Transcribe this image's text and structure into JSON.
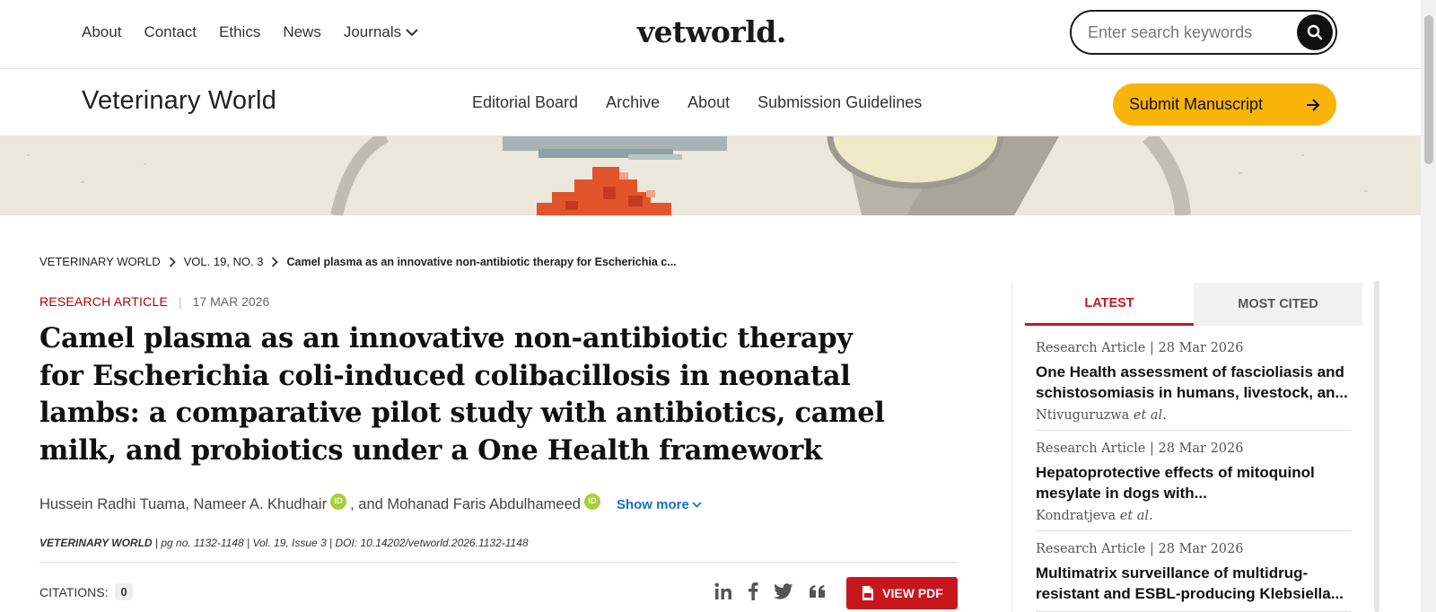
{
  "topnav": {
    "items": [
      "About",
      "Contact",
      "Ethics",
      "News"
    ],
    "journals_label": "Journals"
  },
  "site_logo": "vetworld.",
  "search": {
    "placeholder": "Enter search keywords"
  },
  "journal": {
    "title": "Veterinary World",
    "nav": [
      "Editorial Board",
      "Archive",
      "About",
      "Submission Guidelines"
    ],
    "submit_label": "Submit Manuscript"
  },
  "breadcrumb": {
    "items": [
      "VETERINARY WORLD",
      "VOL. 19, NO. 3"
    ],
    "current": "Camel plasma as an innovative non-antibiotic therapy for Escherichia c..."
  },
  "article": {
    "type": "RESEARCH ARTICLE",
    "date": "17 MAR 2026",
    "title": "Camel plasma as an innovative non-antibiotic therapy for Escherichia coli-induced colibacillosis in neonatal lambs: a comparative pilot study with antibiotics, camel milk, and probiotics under a One Health framework",
    "authors": {
      "a1": "Hussein Radhi Tuama, Nameer A. Khudhair",
      "a2": ", and Mohanad Faris Abdulhameed",
      "orcid_label": "iD",
      "show_more": "Show more"
    },
    "citation": {
      "journal": "VETERINARY WORLD",
      "rest": " | pg no. 1132-1148 | Vol. 19, Issue 3 | DOI: 10.14202/vetworld.2026.1132-1148"
    },
    "citations_label": "CITATIONS:",
    "citations_count": "0",
    "view_pdf": "VIEW PDF"
  },
  "sidebar": {
    "tabs": [
      "LATEST",
      "MOST CITED"
    ],
    "items": [
      {
        "meta": "Research Article | 28 Mar 2026",
        "title": "One Health assessment of fascioliasis and schistosomiasis in humans, livestock, an...",
        "author": "Ntivuguruzwa",
        "etal": "et al."
      },
      {
        "meta": "Research Article | 28 Mar 2026",
        "title": "Hepatoprotective effects of mitoquinol mesylate in dogs with...",
        "author": "Kondratjeva",
        "etal": "et al."
      },
      {
        "meta": "Research Article | 28 Mar 2026",
        "title": "Multimatrix surveillance of multidrug-resistant and ESBL-producing Klebsiella...",
        "author": "",
        "etal": ""
      }
    ]
  },
  "colors": {
    "accent_red": "#c8161d",
    "submit_yellow": "#f9b409",
    "orcid_green": "#a6ce39",
    "link_blue": "#1a6fc0"
  }
}
